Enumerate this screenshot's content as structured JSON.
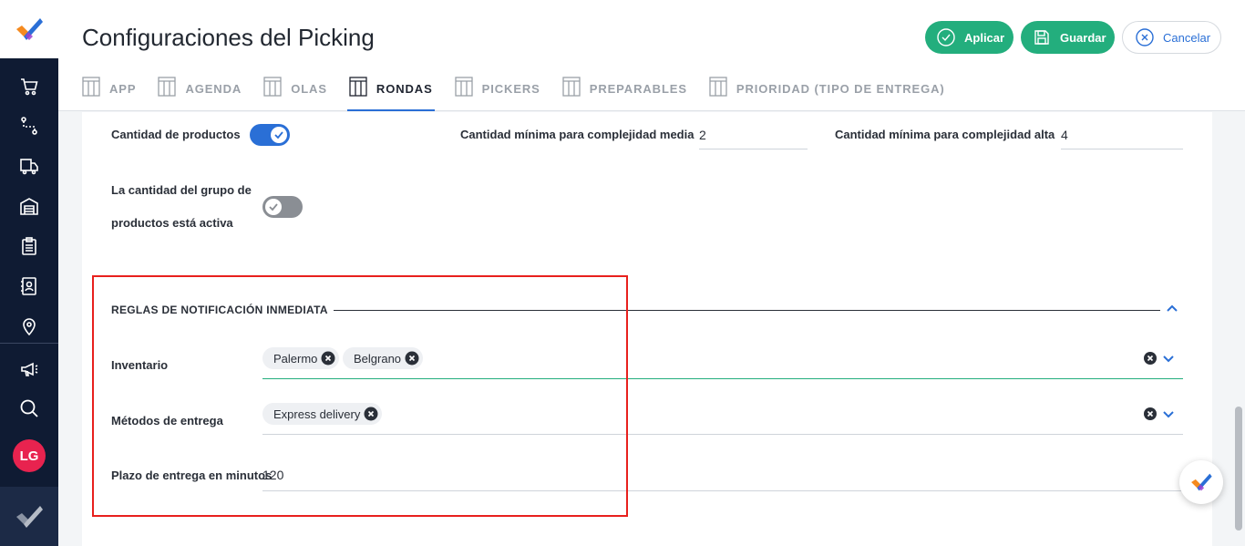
{
  "header": {
    "title": "Configuraciones del Picking",
    "buttons": {
      "apply": "Aplicar",
      "save": "Guardar",
      "cancel": "Cancelar"
    }
  },
  "tabs": [
    {
      "label": "APP",
      "active": false
    },
    {
      "label": "AGENDA",
      "active": false
    },
    {
      "label": "OLAS",
      "active": false
    },
    {
      "label": "RONDAS",
      "active": true
    },
    {
      "label": "PICKERS",
      "active": false
    },
    {
      "label": "PREPARABLES",
      "active": false
    },
    {
      "label": "PRIORIDAD (TIPO DE ENTREGA)",
      "active": false
    }
  ],
  "sidebar": {
    "icons": [
      "cart-icon",
      "route-icon",
      "delivery-truck-icon",
      "warehouse-icon",
      "clipboard-icon",
      "contacts-icon",
      "location-pin-icon",
      "megaphone-icon",
      "search-icon"
    ],
    "avatar_initials": "LG"
  },
  "rondas": {
    "product_quantity_label": "Cantidad de productos",
    "product_quantity_enabled": true,
    "min_medium_label": "Cantidad mínima para complejidad media",
    "min_medium_value": "2",
    "min_high_label": "Cantidad mínima para complejidad alta",
    "min_high_value": "4",
    "group_active_label_line1": "La cantidad del grupo de",
    "group_active_label_line2": "productos está activa",
    "group_active_enabled": false
  },
  "notification_rules": {
    "title": "REGLAS DE NOTIFICACIÓN INMEDIATA",
    "inventory_label": "Inventario",
    "inventory_chips": [
      "Palermo",
      "Belgrano"
    ],
    "delivery_methods_label": "Métodos de entrega",
    "delivery_methods_chips": [
      "Express delivery"
    ],
    "delivery_deadline_label": "Plazo de entrega en minutos",
    "delivery_deadline_value": "120"
  },
  "colors": {
    "primary_green": "#23ae7d",
    "primary_blue": "#2a6fd6",
    "sidebar_dark": "#0f1b33",
    "avatar_red": "#e8234f",
    "highlight_red": "#e8201d"
  }
}
